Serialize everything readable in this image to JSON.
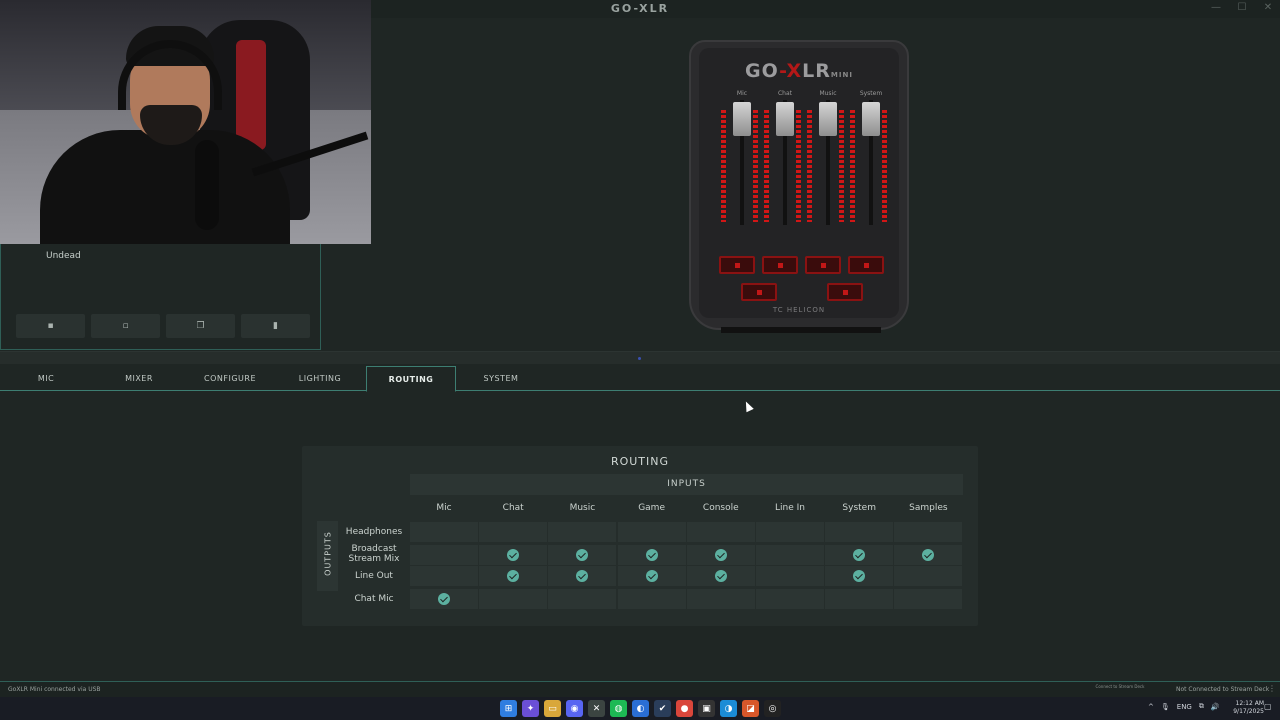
{
  "window": {
    "logo_text": "GO-XLR",
    "controls": [
      "—",
      "☐",
      "✕"
    ]
  },
  "profile": {
    "name": "Undead",
    "buttons": [
      {
        "icon": "save-icon",
        "glyph": "▪"
      },
      {
        "icon": "new-file-icon",
        "glyph": "▫"
      },
      {
        "icon": "copy-icon",
        "glyph": "❐"
      },
      {
        "icon": "delete-icon",
        "glyph": "▮"
      }
    ]
  },
  "device": {
    "logo_left": "GO",
    "logo_x": "-X",
    "logo_right": "LR",
    "logo_mini": "MINI",
    "faders": [
      "Mic",
      "Chat",
      "Music",
      "System"
    ],
    "brand": "TC HELICON"
  },
  "tabs": [
    {
      "label": "MIC",
      "active": false
    },
    {
      "label": "MIXER",
      "active": false
    },
    {
      "label": "CONFIGURE",
      "active": false
    },
    {
      "label": "LIGHTING",
      "active": false
    },
    {
      "label": "ROUTING",
      "active": true
    },
    {
      "label": "SYSTEM",
      "active": false
    }
  ],
  "routing": {
    "title": "ROUTING",
    "inputs_label": "INPUTS",
    "outputs_label": "OUTPUTS",
    "inputs": [
      "Mic",
      "Chat",
      "Music",
      "Game",
      "Console",
      "Line In",
      "System",
      "Samples"
    ],
    "outputs": [
      {
        "label": "Headphones",
        "routes": [
          false,
          false,
          false,
          false,
          false,
          false,
          false,
          false
        ]
      },
      {
        "label": "Broadcast Stream Mix",
        "routes": [
          false,
          true,
          true,
          true,
          true,
          false,
          true,
          true
        ]
      },
      {
        "label": "Line Out",
        "routes": [
          false,
          true,
          true,
          true,
          true,
          false,
          true,
          false
        ]
      },
      {
        "label": "Chat Mic",
        "routes": [
          true,
          false,
          false,
          false,
          false,
          false,
          false,
          false
        ]
      }
    ]
  },
  "status": {
    "left": "GoXLR Mini connected via USB",
    "deck_small": "Connect to Stream Deck",
    "right": "Not Connected to Stream Deck",
    "grip": "⋮"
  },
  "taskbar": {
    "apps": [
      {
        "name": "start-icon",
        "glyph": "⊞",
        "color": "#2f7de0"
      },
      {
        "name": "copilot-icon",
        "glyph": "✦",
        "color": "#6a4fd6"
      },
      {
        "name": "file-explorer-icon",
        "glyph": "▭",
        "color": "#d9a73a"
      },
      {
        "name": "discord-icon",
        "glyph": "◉",
        "color": "#5865f2"
      },
      {
        "name": "goxlr-icon",
        "glyph": "✕",
        "color": "#3b4441"
      },
      {
        "name": "spotify-icon",
        "glyph": "◍",
        "color": "#1db954"
      },
      {
        "name": "edge-dev-icon",
        "glyph": "◐",
        "color": "#2a6ed4"
      },
      {
        "name": "steam-icon",
        "glyph": "✔",
        "color": "#2a3d5a"
      },
      {
        "name": "chrome-icon",
        "glyph": "●",
        "color": "#d9463b"
      },
      {
        "name": "epic-icon",
        "glyph": "▣",
        "color": "#333"
      },
      {
        "name": "edge-icon",
        "glyph": "◑",
        "color": "#1b8cd6"
      },
      {
        "name": "office-icon",
        "glyph": "◪",
        "color": "#d8572a"
      },
      {
        "name": "obs-icon",
        "glyph": "◎",
        "color": "#222"
      }
    ],
    "tray_items": [
      "^",
      "🎙",
      "ENG",
      "⧉",
      "🔊"
    ],
    "time": "12:12 AM",
    "date": "9/17/2025"
  }
}
